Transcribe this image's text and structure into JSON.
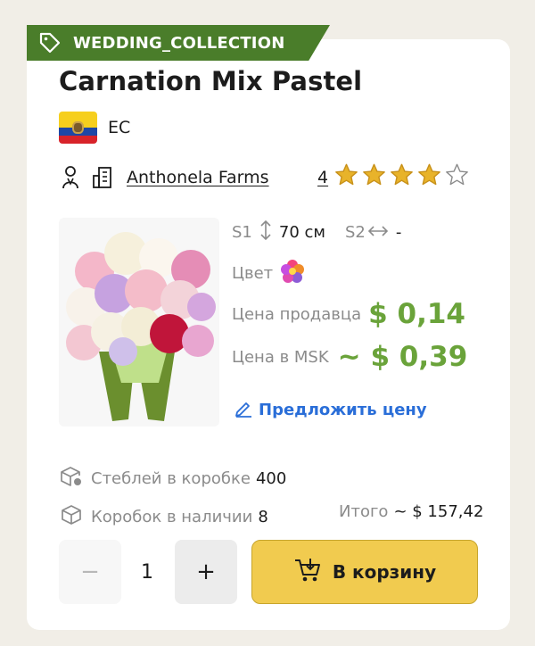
{
  "collection_tag": {
    "label": "WEDDING_COLLECTION",
    "icon": "tag-icon",
    "color": "#4a7d2a"
  },
  "product": {
    "title": "Carnation Mix Pastel",
    "country_code": "EC",
    "flag_icon": "ecuador-flag-icon",
    "farm": "Anthonela Farms",
    "rating": "4",
    "rating_value": 4,
    "rating_max": 5
  },
  "specs": {
    "s1_label": "S1",
    "s1_value": "70 см",
    "s2_label": "S2",
    "s2_value": "-",
    "color_label": "Цвет",
    "seller_price_label": "Цена продавца",
    "seller_price": "$ 0,14",
    "msk_price_label": "Цена в MSK",
    "msk_price": "~ $ 0,39",
    "offer_label": "Предложить цену"
  },
  "stats": {
    "stems_label": "Стеблей в коробке",
    "stems_value": "400",
    "boxes_label": "Коробок в наличии",
    "boxes_value": "8",
    "total_label": "Итого",
    "total_value": "~ $ 157,42"
  },
  "cart": {
    "minus": "−",
    "quantity": "1",
    "plus": "+",
    "button_label": "В корзину"
  },
  "colors": {
    "price_green": "#6aa33a",
    "link_blue": "#2a6ed8",
    "cart_yellow": "#f1cb4f",
    "star_yellow": "#e8b32a"
  }
}
